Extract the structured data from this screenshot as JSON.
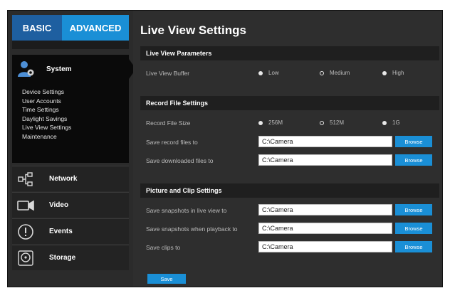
{
  "tabs": {
    "basic": "BASIC",
    "advanced": "ADVANCED"
  },
  "sidebar": {
    "system": {
      "label": "System",
      "icon": "person-gear-icon",
      "items": [
        "Device Settings",
        "User Accounts",
        "Time Settings",
        "Daylight Savings",
        "Live View Settings",
        "Maintenance"
      ]
    },
    "network": {
      "label": "Network",
      "icon": "network-icon"
    },
    "video": {
      "label": "Video",
      "icon": "video-camera-icon"
    },
    "events": {
      "label": "Events",
      "icon": "alert-icon"
    },
    "storage": {
      "label": "Storage",
      "icon": "hard-disk-icon"
    }
  },
  "page_title": "Live View Settings",
  "live_view": {
    "header": "Live View Parameters",
    "buffer_label": "Live View Buffer",
    "options": [
      "Low",
      "Medium",
      "High"
    ],
    "selected": "Medium"
  },
  "record": {
    "header": "Record File Settings",
    "size_label": "Record File Size",
    "size_options": [
      "256M",
      "512M",
      "1G"
    ],
    "selected_size": "512M",
    "save_record_label": "Save record files to",
    "save_record_value": "C:\\Camera",
    "save_download_label": "Save downloaded files to",
    "save_download_value": "C:\\Camera"
  },
  "picture": {
    "header": "Picture and Clip Settings",
    "snap_live_label": "Save snapshots in live view to",
    "snap_live_value": "C:\\Camera",
    "snap_playback_label": "Save snapshots when playback to",
    "snap_playback_value": "C:\\Camera",
    "clips_label": "Save clips to",
    "clips_value": "C:\\Camera"
  },
  "buttons": {
    "browse": "Browse",
    "save": "Save"
  },
  "colors": {
    "accent": "#1a8fd6",
    "accent_dark": "#1e5fa0",
    "panel": "#2e2e2e",
    "sidebar_active": "#0a0a0a"
  }
}
